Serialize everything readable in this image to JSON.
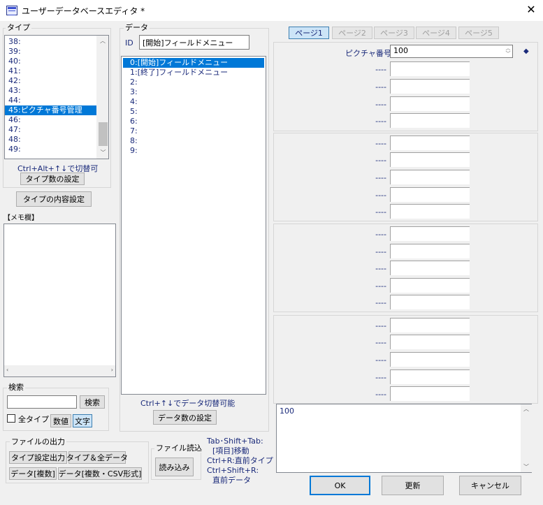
{
  "window": {
    "title": "ユーザーデータベースエディタ *",
    "close": "✕"
  },
  "type_group": {
    "label": "タイプ",
    "items": [
      {
        "label": "38:",
        "selected": false
      },
      {
        "label": "39:",
        "selected": false
      },
      {
        "label": "40:",
        "selected": false
      },
      {
        "label": "41:",
        "selected": false
      },
      {
        "label": "42:",
        "selected": false
      },
      {
        "label": "43:",
        "selected": false
      },
      {
        "label": "44:",
        "selected": false
      },
      {
        "label": "45:ピクチャ番号管理",
        "selected": true
      },
      {
        "label": "46:",
        "selected": false
      },
      {
        "label": "47:",
        "selected": false
      },
      {
        "label": "48:",
        "selected": false
      },
      {
        "label": "49:",
        "selected": false
      }
    ],
    "hint": "Ctrl+Alt+↑↓で切替可",
    "count_button": "タイプ数の設定",
    "content_button": "タイプの内容設定"
  },
  "memo": {
    "label": "【メモ欄】"
  },
  "search": {
    "label": "検索",
    "button": "検索",
    "value": "",
    "all_types_label": "全タイプ",
    "all_types_checked": false,
    "num_button": "数値",
    "text_button": "文字"
  },
  "file_output": {
    "label": "ファイルの出力",
    "type_settings": "タイプ設定出力",
    "type_all_data": "タイプ＆全データ",
    "data_multi": "データ[複数]",
    "data_csv": "データ[複数・CSV形式]"
  },
  "file_read": {
    "label": "ファイル読込",
    "button": "読み込み"
  },
  "shortcuts": {
    "line1": "Tab･Shift+Tab:",
    "line2": "[項目]移動",
    "line3": "Ctrl+R:直前タイプ",
    "line4": "Ctrl+Shift+R:",
    "line5": "直前データ"
  },
  "data_group": {
    "label": "データ",
    "id_label": "ID",
    "id_value": "[開始]フィールドメニュー",
    "items": [
      {
        "label": "0:[開始]フィールドメニュー",
        "selected": true
      },
      {
        "label": "1:[終了]フィールドメニュー",
        "selected": false
      },
      {
        "label": "2:",
        "selected": false
      },
      {
        "label": "3:",
        "selected": false
      },
      {
        "label": "4:",
        "selected": false
      },
      {
        "label": "5:",
        "selected": false
      },
      {
        "label": "6:",
        "selected": false
      },
      {
        "label": "7:",
        "selected": false
      },
      {
        "label": "8:",
        "selected": false
      },
      {
        "label": "9:",
        "selected": false
      }
    ],
    "hint": "Ctrl+↑↓でデータ切替可能",
    "count_button": "データ数の設定"
  },
  "pages": {
    "tabs": [
      "ページ1",
      "ページ2",
      "ページ3",
      "ページ4",
      "ページ5"
    ],
    "active": 0
  },
  "fields": {
    "first_label": "ピクチャ番号",
    "first_value": "100",
    "dash": "----",
    "marker": "◆"
  },
  "note_value": "100",
  "buttons": {
    "ok": "OK",
    "update": "更新",
    "cancel": "キャンセル"
  }
}
